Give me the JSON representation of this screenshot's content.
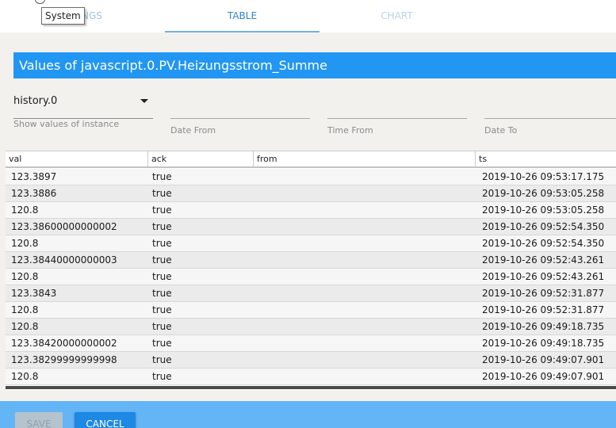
{
  "tabs": {
    "settings_label": "TINGS",
    "table_label": "TABLE",
    "chart_label": "CHART"
  },
  "tooltip": {
    "text": "System"
  },
  "title": "Values of javascript.0.PV.Heizungsstrom_Summe",
  "filters": {
    "instance_value": "history.0",
    "instance_helper": "Show values of instance",
    "date_from_label": "Date From",
    "time_from_label": "Time From",
    "date_to_label": "Date To"
  },
  "table": {
    "columns": [
      "val",
      "ack",
      "from",
      "ts"
    ],
    "rows": [
      {
        "val": "123.3897",
        "ack": "true",
        "from": "",
        "ts": "2019-10-26 09:53:17.175"
      },
      {
        "val": "123.3886",
        "ack": "true",
        "from": "",
        "ts": "2019-10-26 09:53:05.258"
      },
      {
        "val": "120.8",
        "ack": "true",
        "from": "",
        "ts": "2019-10-26 09:53:05.258"
      },
      {
        "val": "123.38600000000002",
        "ack": "true",
        "from": "",
        "ts": "2019-10-26 09:52:54.350"
      },
      {
        "val": "120.8",
        "ack": "true",
        "from": "",
        "ts": "2019-10-26 09:52:54.350"
      },
      {
        "val": "123.38440000000003",
        "ack": "true",
        "from": "",
        "ts": "2019-10-26 09:52:43.261"
      },
      {
        "val": "120.8",
        "ack": "true",
        "from": "",
        "ts": "2019-10-26 09:52:43.261"
      },
      {
        "val": "123.3843",
        "ack": "true",
        "from": "",
        "ts": "2019-10-26 09:52:31.877"
      },
      {
        "val": "120.8",
        "ack": "true",
        "from": "",
        "ts": "2019-10-26 09:52:31.877"
      },
      {
        "val": "120.8",
        "ack": "true",
        "from": "",
        "ts": "2019-10-26 09:49:18.735"
      },
      {
        "val": "123.38420000000002",
        "ack": "true",
        "from": "",
        "ts": "2019-10-26 09:49:18.735"
      },
      {
        "val": "123.38299999999998",
        "ack": "true",
        "from": "",
        "ts": "2019-10-26 09:49:07.901"
      },
      {
        "val": "120.8",
        "ack": "true",
        "from": "",
        "ts": "2019-10-26 09:49:07.901"
      }
    ]
  },
  "footer": {
    "save_label": "SAVE",
    "cancel_label": "CANCEL"
  },
  "colors": {
    "accent": "#2196f3",
    "footer": "#64b5f6",
    "cancel_button": "#1e88e5"
  }
}
